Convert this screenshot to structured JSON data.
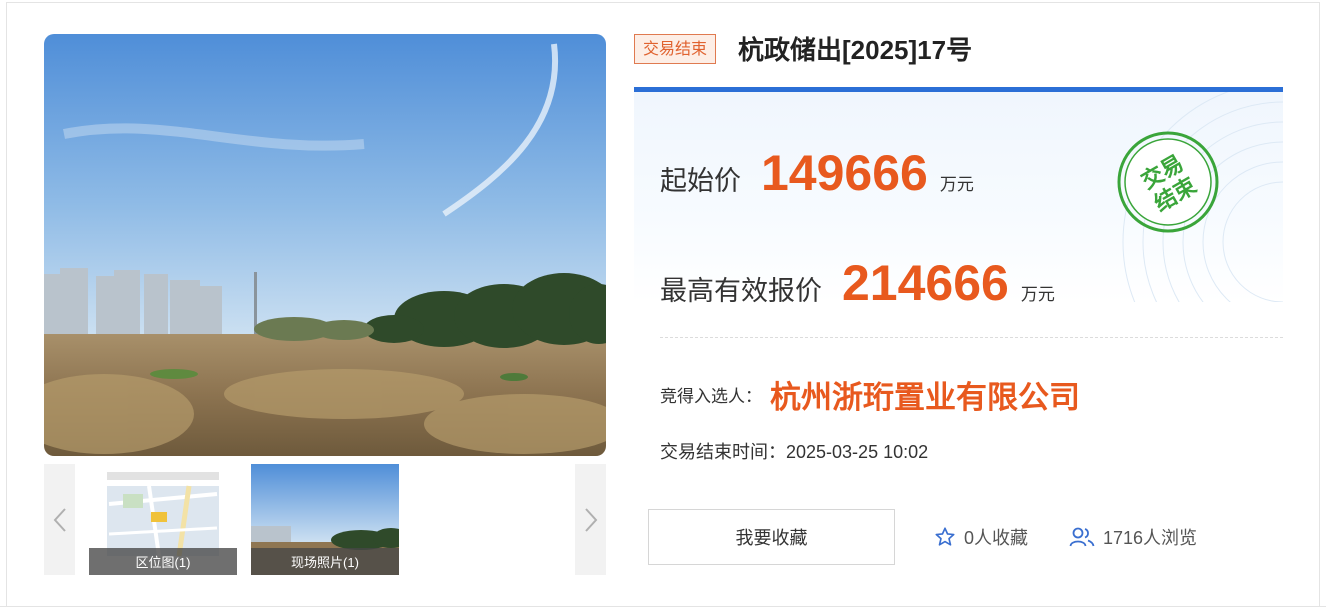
{
  "listing": {
    "status_tag": "交易结束",
    "title": "杭政储出[2025]17号"
  },
  "gallery": {
    "thumbnails": [
      {
        "caption": "区位图(1)"
      },
      {
        "caption": "现场照片(1)"
      }
    ]
  },
  "pricing": {
    "start_label": "起始价",
    "start_value": "149666",
    "start_unit": "万元",
    "highest_label": "最高有效报价",
    "highest_value": "214666",
    "highest_unit": "万元"
  },
  "stamp": {
    "line1": "交易",
    "line2": "结束"
  },
  "result": {
    "winner_label": "竞得入选人：",
    "winner_name": "杭州浙珩置业有限公司",
    "end_time": "交易结束时间：2025-03-25 10:02"
  },
  "actions": {
    "favorite_button": "我要收藏",
    "favorites_count": "0人收藏",
    "views_count": "1716人浏览"
  },
  "colors": {
    "accent_orange": "#e8591e",
    "accent_blue": "#2b6fd6",
    "stamp_green": "#3aa53a"
  },
  "icons": {
    "prev": "chevron-left-icon",
    "next": "chevron-right-icon",
    "favorite": "star-icon",
    "views": "users-icon"
  }
}
